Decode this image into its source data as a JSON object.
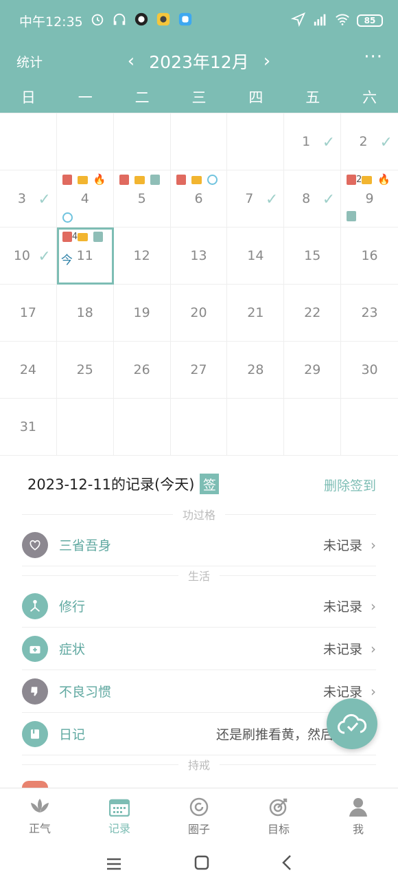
{
  "status_bar": {
    "time": "中午12:35",
    "battery": "85"
  },
  "header": {
    "stats": "统计",
    "month": "2023年12月",
    "prev": "‹",
    "next": "›",
    "more": "···"
  },
  "weekdays": [
    "日",
    "一",
    "二",
    "三",
    "四",
    "五",
    "六"
  ],
  "calendar": {
    "days": [
      "",
      "",
      "",
      "",
      "",
      "1",
      "2",
      "3",
      "4",
      "5",
      "6",
      "7",
      "8",
      "9",
      "10",
      "11",
      "12",
      "13",
      "14",
      "15",
      "16",
      "17",
      "18",
      "19",
      "20",
      "21",
      "22",
      "23",
      "24",
      "25",
      "26",
      "27",
      "28",
      "29",
      "30",
      "31",
      "",
      "",
      "",
      "",
      "",
      ""
    ],
    "checked_days": [
      "1",
      "2",
      "3",
      "7",
      "8",
      "10"
    ],
    "today_label": "今",
    "today_day": "11",
    "badge_9": "2",
    "badge_11": "4"
  },
  "records": {
    "title": "2023-12-11的记录(今天)",
    "sign_badge": "签",
    "delete": "删除签到",
    "sections": [
      "功过格",
      "生活",
      "持戒"
    ],
    "items": [
      {
        "name": "三省吾身",
        "status": "未记录"
      },
      {
        "name": "修行",
        "status": "未记录"
      },
      {
        "name": "症状",
        "status": "未记录"
      },
      {
        "name": "不良习惯",
        "status": "未记录"
      },
      {
        "name": "日记",
        "status": "还是刷推看黄，然后"
      }
    ],
    "arrow": "›"
  },
  "bottom_nav": [
    {
      "label": "正气"
    },
    {
      "label": "记录"
    },
    {
      "label": "圈子"
    },
    {
      "label": "目标"
    },
    {
      "label": "我"
    }
  ],
  "colors": {
    "accent": "#7dbdb4",
    "check": "#9fd0ca",
    "today_label": "#2a7fa6"
  }
}
